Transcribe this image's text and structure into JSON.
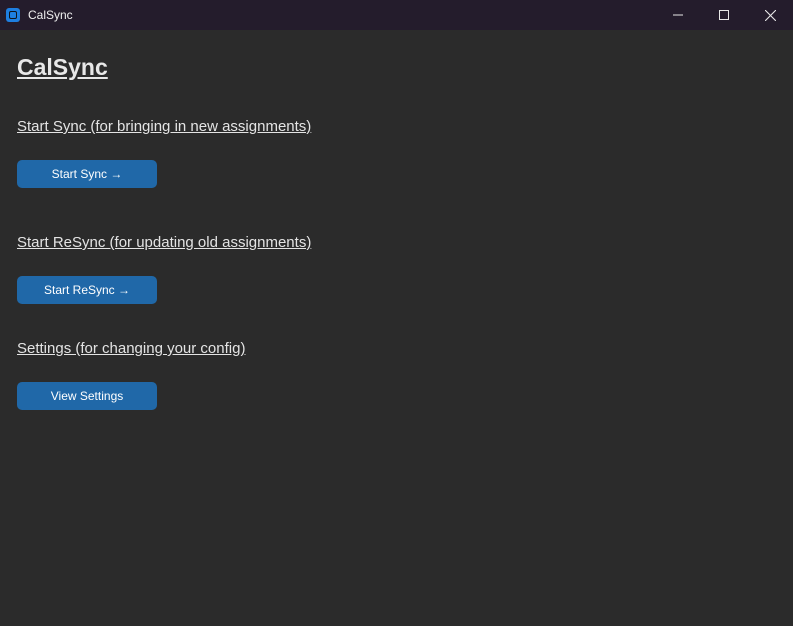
{
  "window": {
    "title": "CalSync",
    "icon": "calsync-app-icon",
    "controls": [
      "minimize-icon",
      "maximize-icon",
      "close-icon"
    ]
  },
  "main": {
    "heading": "CalSync",
    "sections": [
      {
        "label": "Start Sync (for bringing in new assignments)",
        "button": "Start Sync →"
      },
      {
        "label": "Start ReSync (for updating old assignments)",
        "button": "Start ReSync →"
      },
      {
        "label": "Settings (for changing your config)",
        "button": "View Settings"
      }
    ]
  },
  "colors": {
    "background": "#2b2b2b",
    "titlebar": "#241c2c",
    "button": "#2068a8",
    "text": "#e4e4e4"
  }
}
